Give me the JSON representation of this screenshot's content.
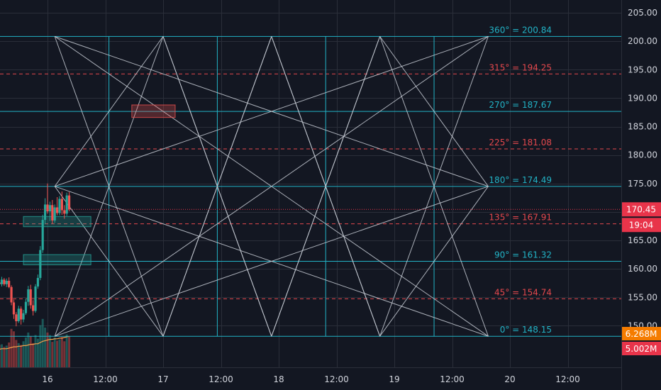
{
  "colors": {
    "background": "#131722",
    "axis_text": "#d1d4dc",
    "grid": "#2a2e39",
    "cyan": "#22b3c6",
    "red": "#e5484d",
    "gann_lines": "#c5cad3",
    "up": "#26a69a",
    "down": "#ef5350",
    "ma": "#f5a04a",
    "badge_red": "#e8344a",
    "badge_orange": "#f57c00",
    "box_red": "#ef5350",
    "box_green": "#26a69a"
  },
  "chart_data": {
    "type": "candlestick",
    "ylim": [
      145.0,
      205.0
    ],
    "y_ticks": [
      {
        "value": 205,
        "label": "205.00"
      },
      {
        "value": 200,
        "label": "200.00"
      },
      {
        "value": 195,
        "label": "195.00"
      },
      {
        "value": 190,
        "label": "190.00"
      },
      {
        "value": 185,
        "label": "185.00"
      },
      {
        "value": 180,
        "label": "180.00"
      },
      {
        "value": 175,
        "label": "175.00"
      },
      {
        "value": 170,
        "label": "170.00"
      },
      {
        "value": 165,
        "label": "165.00"
      },
      {
        "value": 160,
        "label": "160.00"
      },
      {
        "value": 155,
        "label": "155.00"
      },
      {
        "value": 150,
        "label": "150.00"
      }
    ],
    "y_tick_partial": {
      "value": 146.0,
      "label": "145.00"
    },
    "x_ticks": [
      {
        "t": 0,
        "label": "16"
      },
      {
        "t": 12,
        "label": "12:00"
      },
      {
        "t": 24,
        "label": "17"
      },
      {
        "t": 36,
        "label": "12:00"
      },
      {
        "t": 48,
        "label": "18"
      },
      {
        "t": 60,
        "label": "12:00"
      },
      {
        "t": 72,
        "label": "19"
      },
      {
        "t": 84,
        "label": "12:00"
      },
      {
        "t": 96,
        "label": "20"
      },
      {
        "t": 108,
        "label": "12:00"
      }
    ],
    "gann_levels": [
      {
        "value": 200.84,
        "label": "360° = 200.84",
        "style": "solid"
      },
      {
        "value": 194.25,
        "label": "315° = 194.25",
        "style": "dashed"
      },
      {
        "value": 187.67,
        "label": "270° = 187.67",
        "style": "solid"
      },
      {
        "value": 181.08,
        "label": "225° = 181.08",
        "style": "dashed"
      },
      {
        "value": 174.49,
        "label": "180° = 174.49",
        "style": "solid"
      },
      {
        "value": 167.91,
        "label": "135° = 167.91",
        "style": "dashed"
      },
      {
        "value": 161.32,
        "label": "90° = 161.32",
        "style": "solid"
      },
      {
        "value": 154.74,
        "label": "45° = 154.74",
        "style": "dashed"
      },
      {
        "value": 148.15,
        "label": "0° = 148.15",
        "style": "solid"
      }
    ],
    "gann_time_grid": [
      1.5,
      12.75,
      24,
      35.25,
      46.5,
      57.75,
      69,
      80.25,
      91.5
    ],
    "gann_span": {
      "t_start": 1.5,
      "t_end": 91.5,
      "low": 148.15,
      "high": 200.84
    },
    "zones": [
      {
        "t1": 17.5,
        "t2": 26.5,
        "p1": 186.6,
        "p2": 188.8,
        "kind": "red"
      },
      {
        "t1": -5,
        "t2": 9,
        "p1": 167.4,
        "p2": 169.2,
        "kind": "green"
      },
      {
        "t1": -5,
        "t2": 9,
        "p1": 160.7,
        "p2": 162.5,
        "kind": "green"
      }
    ],
    "candles": [
      {
        "t": -13.5,
        "o": 157.8,
        "h": 158.5,
        "l": 156.9,
        "c": 157.2
      },
      {
        "t": -13.0,
        "o": 157.2,
        "h": 158.0,
        "l": 156.4,
        "c": 157.7
      },
      {
        "t": -12.5,
        "o": 157.7,
        "h": 158.8,
        "l": 157.0,
        "c": 157.1
      },
      {
        "t": -12.0,
        "o": 157.1,
        "h": 157.8,
        "l": 156.2,
        "c": 156.7
      },
      {
        "t": -11.5,
        "o": 156.7,
        "h": 158.1,
        "l": 156.5,
        "c": 157.8
      },
      {
        "t": -11.0,
        "o": 157.8,
        "h": 159.2,
        "l": 157.3,
        "c": 158.7
      },
      {
        "t": -10.5,
        "o": 158.7,
        "h": 159.0,
        "l": 157.2,
        "c": 157.6
      },
      {
        "t": -10.0,
        "o": 157.6,
        "h": 158.2,
        "l": 156.8,
        "c": 157.3
      },
      {
        "t": -9.5,
        "o": 157.3,
        "h": 158.6,
        "l": 156.9,
        "c": 158.1
      },
      {
        "t": -9.0,
        "o": 158.1,
        "h": 158.4,
        "l": 157.0,
        "c": 157.3
      },
      {
        "t": -8.5,
        "o": 157.3,
        "h": 158.3,
        "l": 156.8,
        "c": 157.9
      },
      {
        "t": -8.0,
        "o": 157.9,
        "h": 158.5,
        "l": 156.6,
        "c": 156.8
      },
      {
        "t": -7.5,
        "o": 156.8,
        "h": 157.1,
        "l": 153.6,
        "c": 154.1
      },
      {
        "t": -7.0,
        "o": 154.1,
        "h": 154.6,
        "l": 151.2,
        "c": 152.0
      },
      {
        "t": -6.5,
        "o": 152.0,
        "h": 152.4,
        "l": 149.9,
        "c": 150.8
      },
      {
        "t": -6.0,
        "o": 150.8,
        "h": 153.5,
        "l": 150.5,
        "c": 153.0
      },
      {
        "t": -5.5,
        "o": 153.0,
        "h": 153.4,
        "l": 150.2,
        "c": 151.1
      },
      {
        "t": -5.0,
        "o": 151.1,
        "h": 152.8,
        "l": 150.6,
        "c": 152.2
      },
      {
        "t": -4.5,
        "o": 152.2,
        "h": 154.8,
        "l": 151.9,
        "c": 154.2
      },
      {
        "t": -4.0,
        "o": 154.2,
        "h": 157.0,
        "l": 153.5,
        "c": 156.4
      },
      {
        "t": -3.5,
        "o": 156.4,
        "h": 157.2,
        "l": 153.0,
        "c": 153.6
      },
      {
        "t": -3.0,
        "o": 153.6,
        "h": 154.5,
        "l": 151.8,
        "c": 152.6
      },
      {
        "t": -2.5,
        "o": 152.6,
        "h": 157.3,
        "l": 152.3,
        "c": 156.9
      },
      {
        "t": -2.0,
        "o": 156.9,
        "h": 159.0,
        "l": 156.5,
        "c": 158.4
      },
      {
        "t": -1.5,
        "o": 158.4,
        "h": 164.0,
        "l": 158.0,
        "c": 163.3
      },
      {
        "t": -1.0,
        "o": 163.3,
        "h": 169.5,
        "l": 162.8,
        "c": 168.6
      },
      {
        "t": -0.5,
        "o": 168.6,
        "h": 172.4,
        "l": 167.9,
        "c": 171.3
      },
      {
        "t": 0.0,
        "o": 171.3,
        "h": 175.0,
        "l": 169.7,
        "c": 170.1
      },
      {
        "t": 0.5,
        "o": 170.1,
        "h": 171.8,
        "l": 168.4,
        "c": 171.2
      },
      {
        "t": 1.0,
        "o": 171.2,
        "h": 172.1,
        "l": 167.9,
        "c": 168.5
      },
      {
        "t": 1.5,
        "o": 168.5,
        "h": 171.3,
        "l": 168.1,
        "c": 170.8
      },
      {
        "t": 2.0,
        "o": 170.8,
        "h": 172.6,
        "l": 169.4,
        "c": 169.8
      },
      {
        "t": 2.5,
        "o": 169.8,
        "h": 172.8,
        "l": 169.4,
        "c": 172.3
      },
      {
        "t": 3.0,
        "o": 172.3,
        "h": 173.6,
        "l": 169.5,
        "c": 170.3
      },
      {
        "t": 3.5,
        "o": 170.3,
        "h": 171.2,
        "l": 168.8,
        "c": 169.7
      },
      {
        "t": 4.0,
        "o": 169.7,
        "h": 173.4,
        "l": 169.3,
        "c": 172.9
      },
      {
        "t": 4.5,
        "o": 172.9,
        "h": 173.5,
        "l": 170.1,
        "c": 170.45
      }
    ],
    "volume": {
      "max": 8.0,
      "values": [
        3.6,
        3.8,
        3.2,
        3.5,
        3.9,
        4.1,
        3.4,
        3.6,
        3.7,
        3.3,
        3.5,
        4.0,
        6.2,
        5.8,
        4.4,
        3.9,
        3.6,
        4.2,
        4.8,
        5.6,
        5.0,
        3.9,
        5.2,
        4.6,
        6.8,
        7.8,
        6.4,
        5.6,
        5.2,
        4.1,
        4.8,
        4.3,
        4.5,
        4.9,
        4.2,
        5.3,
        5.0
      ]
    },
    "volume_ma": [
      2.6,
      2.7,
      2.7,
      2.8,
      2.8,
      2.9,
      2.9,
      2.9,
      3.0,
      3.0,
      3.0,
      3.1,
      3.2,
      3.3,
      3.3,
      3.4,
      3.4,
      3.5,
      3.5,
      3.6,
      3.7,
      3.7,
      3.8,
      3.8,
      4.0,
      4.2,
      4.3,
      4.4,
      4.5,
      4.5,
      4.6,
      4.6,
      4.7,
      4.7,
      4.8,
      4.9,
      5.0
    ],
    "last_price": {
      "value": 170.45,
      "label": "170.45",
      "countdown": "19:04"
    },
    "volume_badges": [
      {
        "label": "6.268M",
        "kind": "orange"
      },
      {
        "label": "5.002M",
        "kind": "red"
      }
    ]
  }
}
